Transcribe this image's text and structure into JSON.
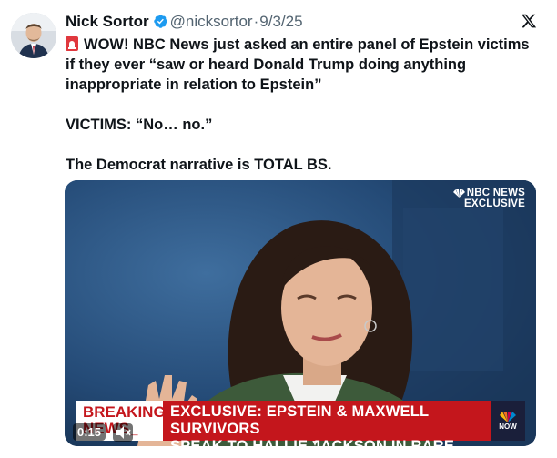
{
  "author": {
    "name": "Nick Sortor",
    "handle": "@nicksortor",
    "separator": "·",
    "date": "9/3/25",
    "verified": true
  },
  "tweet": {
    "line1": "WOW! NBC News just asked an entire panel of Epstein victims if they ever “saw or heard Donald Trump doing anything inappropriate in relation to Epstein”",
    "line2": "VICTIMS: “No… no.”",
    "line3": "The Democrat narrative is TOTAL BS."
  },
  "video": {
    "network_line1": "NBC NEWS",
    "network_line2": "EXCLUSIVE",
    "breaking_line1": "BREAKING",
    "breaking_line2": "NEWS_",
    "headline_line1": "EXCLUSIVE: EPSTEIN & MAXWELL SURVIVORS",
    "headline_line2": "SPEAK TO HALLIE JACKSON IN RARE INTERVIEW",
    "now_label": "NOW",
    "timestamp": "0:15"
  },
  "colors": {
    "verified": "#1d9bf0",
    "headline_red": "#c4161c",
    "text": "#0f1419",
    "muted": "#536471"
  },
  "icons": [
    "avatar",
    "verified-badge-icon",
    "x-logo-icon",
    "siren-icon",
    "nbc-peacock-icon",
    "speaker-icon"
  ]
}
